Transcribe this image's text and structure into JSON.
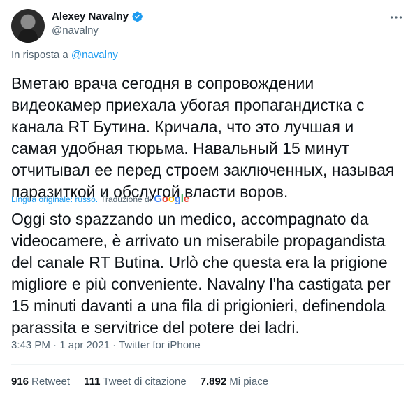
{
  "author": {
    "display_name": "Alexey Navalny",
    "handle": "@navalny",
    "verified": true
  },
  "reply": {
    "prefix": "In risposta a",
    "mention": "@navalny"
  },
  "tweet": {
    "text": "Вметаю врача сегодня в сопровождении видеокамер приехала убогая пропагандистка с канала RT Бутина. Кричала, что это лучшая и самая удобная тюрьма. Навальный 15 минут отчитывал ее перед строем заключенных, называя паразиткой и обслугой власти воров.",
    "original_language": "Lingua originale: russo.",
    "translation_link": "Traduzione di",
    "translator_logo": "Google",
    "translated_text": "Oggi sto spazzando un medico, accompagnato da videocamere, è arrivato un miserabile propagandista del canale RT Butina. Urlò che questa era la prigione migliore e più conveniente. Navalny l'ha castigata per 15 minuti davanti a una fila di prigionieri, definendola parassita e servitrice del potere dei ladri."
  },
  "meta": {
    "time": "3:43 PM",
    "date": "1 apr 2021",
    "source": "Twitter for iPhone",
    "separator": "·"
  },
  "stats": {
    "retweets": {
      "count": "916",
      "label": "Retweet"
    },
    "quotes": {
      "count": "111",
      "label": "Tweet di citazione"
    },
    "likes": {
      "count": "7.892",
      "label": "Mi piace"
    }
  },
  "colors": {
    "accent": "#1d9bf0",
    "text": "#0f1419",
    "secondary": "#536471",
    "divider": "#eff3f4"
  },
  "icons": {
    "verified": "verified-badge-icon",
    "more": "more-options-icon"
  }
}
